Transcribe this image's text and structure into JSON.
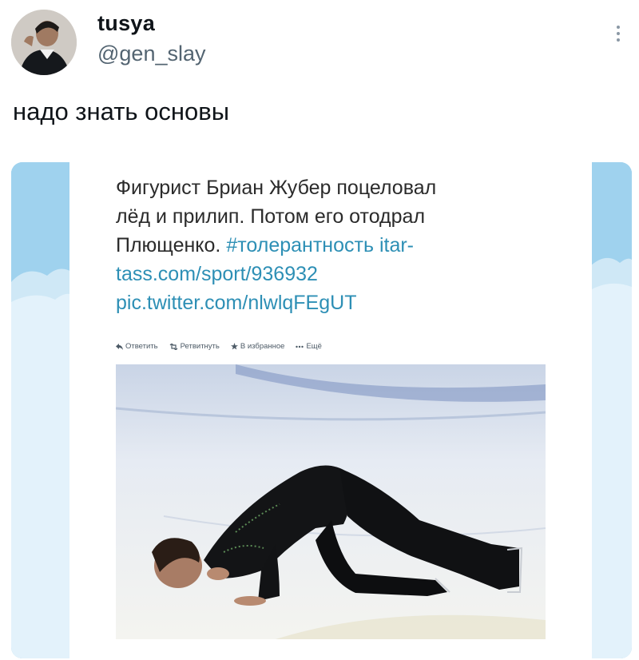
{
  "author": {
    "display_name": "tusya",
    "handle": "@gen_slay"
  },
  "tweet": {
    "text": "надо знать основы"
  },
  "quoted": {
    "line1": "Фигурист Бриан Жубер поцеловал",
    "line2": "лёд и прилип. Потом его отодрал",
    "line3_text": "Плющенко. ",
    "line3_hashtag": "#толерантность",
    "line3_link": " itar-",
    "line4_link": "tass.com/sport/936932",
    "line5_link": "pic.twitter.com/nlwlqFEgUT",
    "actions": {
      "reply": "Ответить",
      "retweet": "Ретвитнуть",
      "favorite": "В избранное",
      "more": "Ещё"
    }
  },
  "icons": {
    "more": "vertical-dots-icon",
    "reply": "reply-arrow-icon",
    "retweet": "retweet-icon",
    "favorite": "star-icon",
    "more_actions": "ellipsis-icon"
  },
  "colors": {
    "handle": "#536471",
    "link": "#2d8fb5",
    "sky": "#9fd2ee"
  }
}
